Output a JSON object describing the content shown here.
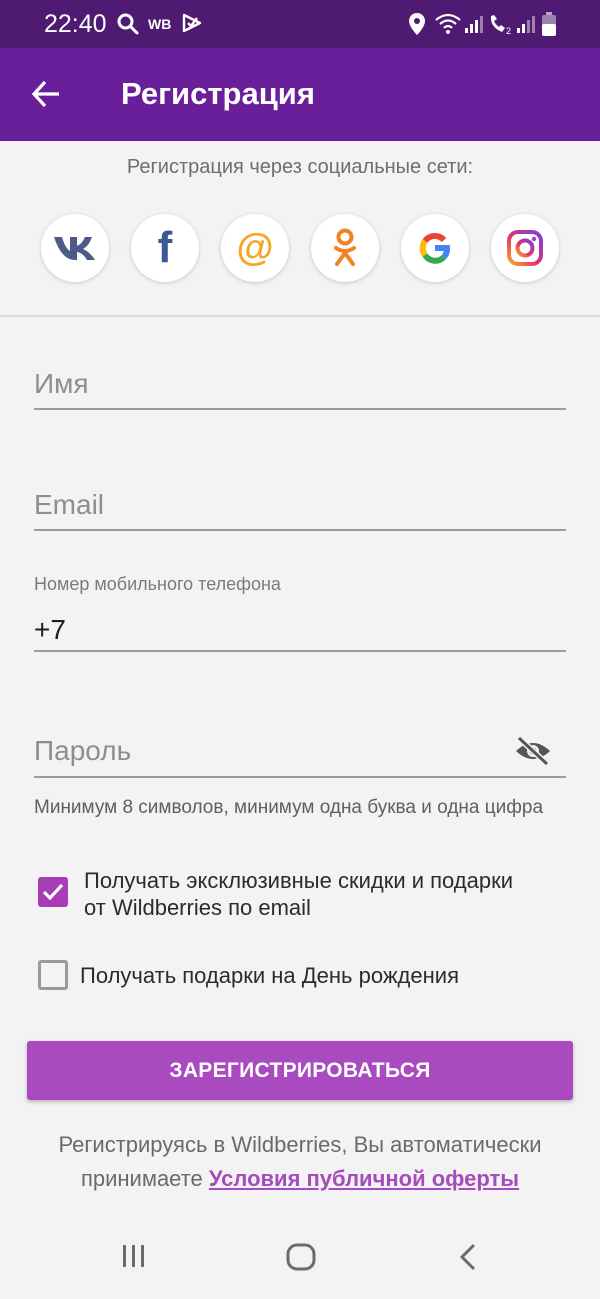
{
  "status_bar": {
    "time": "22:40",
    "carrier": "WB",
    "icons": [
      "search-icon",
      "wb-icon",
      "tick-icon",
      "location-icon",
      "wifi-icon",
      "signal-icon",
      "call-signal-icon",
      "signal-2-icon",
      "battery-icon"
    ]
  },
  "app_bar": {
    "title": "Регистрация",
    "back_icon": "arrow-back-icon"
  },
  "social": {
    "caption": "Регистрация через социальные сети:",
    "buttons": [
      {
        "name": "vk",
        "label": "VK"
      },
      {
        "name": "facebook",
        "label": "f"
      },
      {
        "name": "mail",
        "label": "@"
      },
      {
        "name": "odnoklassniki",
        "label": ""
      },
      {
        "name": "google",
        "label": "G"
      },
      {
        "name": "instagram",
        "label": ""
      }
    ]
  },
  "form": {
    "name": {
      "placeholder": "Имя",
      "value": ""
    },
    "email": {
      "placeholder": "Email",
      "value": ""
    },
    "phone": {
      "label": "Номер мобильного телефона",
      "value": "+7"
    },
    "password": {
      "placeholder": "Пароль",
      "value": ""
    },
    "password_hint": "Минимум 8 символов, минимум одна буква и одна цифра"
  },
  "checkboxes": {
    "discounts": {
      "label_line1": "Получать эксклюзивные скидки и подарки",
      "label_line2": "от Wildberries по email",
      "checked": true
    },
    "birthday": {
      "label": "Получать подарки на День рождения",
      "checked": false
    }
  },
  "register_button": "ЗАРЕГИСТРИРОВАТЬСЯ",
  "terms": {
    "line1": "Регистрируясь в Wildberries, Вы автоматически",
    "line2_prefix": "принимаете ",
    "link": "Условия публичной оферты"
  },
  "colors": {
    "status_bar": "#4f1b72",
    "app_bar": "#6a1f9a",
    "accent": "#a94ac1",
    "link": "#a64bbd"
  },
  "nav_bar": {
    "icons": [
      "recent-apps-icon",
      "home-icon",
      "back-icon"
    ]
  }
}
